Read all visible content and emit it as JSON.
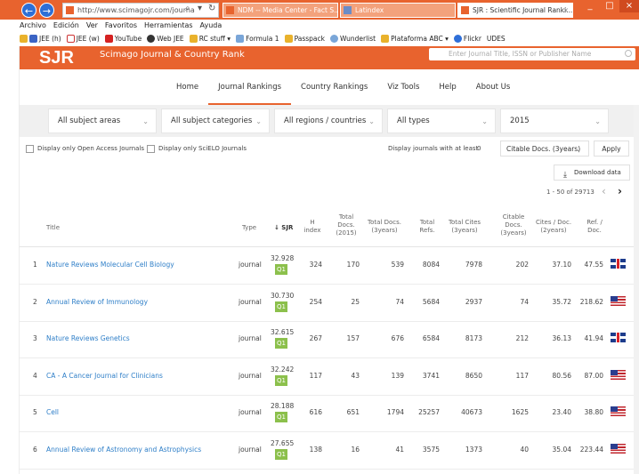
{
  "browser": {
    "address": "http://www.scimagojr.com/journa",
    "tabs": [
      {
        "label": "NDM -- Media Center - Fact S..."
      },
      {
        "label": "Latindex"
      },
      {
        "label": "SJR : Scientific Journal Ranki..."
      }
    ],
    "menu": [
      "Archivo",
      "Edición",
      "Ver",
      "Favoritos",
      "Herramientas",
      "Ayuda"
    ],
    "bookmarks": [
      "JEE (h)",
      "JEE (w)",
      "YouTube",
      "Web JEE",
      "RC stuff ▾",
      "Formula 1",
      "Passpack",
      "Wunderlist",
      "Plataforma ABC ▾",
      "Flickr",
      "UDES"
    ],
    "colors": {
      "chrome": "#e8632e",
      "link": "#2f7fc8",
      "quartile": "#8cc04c"
    }
  },
  "site": {
    "logo": "SJR",
    "subtitle": "Scimago Journal & Country Rank",
    "search_placeholder": "Enter Journal Title, ISSN or Publisher Name",
    "nav": [
      "Home",
      "Journal Rankings",
      "Country Rankings",
      "Viz Tools",
      "Help",
      "About Us"
    ]
  },
  "filters": {
    "subject_areas": "All subject areas",
    "subject_categories": "All subject categories",
    "regions": "All regions / countries",
    "types": "All types",
    "year": "2015"
  },
  "options": {
    "open_access": "Display only Open Access Journals",
    "scielo": "Display only SciELO Journals",
    "min_label": "Display journals with at least",
    "min_value": "0",
    "citable": "Citable Docs. (3years)",
    "apply": "Apply",
    "download": "Download data",
    "pager": "1 - 50 of 29713"
  },
  "table": {
    "headers": {
      "title": "Title",
      "type": "Type",
      "sjr": "↓ SJR",
      "h_index": "H index",
      "total_docs_2015": "Total Docs. (2015)",
      "total_docs_3y": "Total Docs. (3years)",
      "total_refs": "Total Refs.",
      "total_cites_3y": "Total Cites (3years)",
      "citable_docs_3y": "Citable Docs. (3years)",
      "cites_doc_2y": "Cites / Doc. (2years)",
      "ref_doc": "Ref. / Doc."
    },
    "rows": [
      {
        "rank": "1",
        "title": "Nature Reviews Molecular Cell Biology",
        "type": "journal",
        "sjr": "32.928",
        "q": "Q1",
        "h": "324",
        "docs2015": "170",
        "docs3y": "539",
        "refs": "8084",
        "cites": "7978",
        "citable": "202",
        "cites_doc": "37.10",
        "ref_doc": "47.55",
        "flag": "gb"
      },
      {
        "rank": "2",
        "title": "Annual Review of Immunology",
        "type": "journal",
        "sjr": "30.730",
        "q": "Q1",
        "h": "254",
        "docs2015": "25",
        "docs3y": "74",
        "refs": "5684",
        "cites": "2937",
        "citable": "74",
        "cites_doc": "35.72",
        "ref_doc": "218.62",
        "flag": "us"
      },
      {
        "rank": "3",
        "title": "Nature Reviews Genetics",
        "type": "journal",
        "sjr": "32.615",
        "q": "Q1",
        "h": "267",
        "docs2015": "157",
        "docs3y": "676",
        "refs": "6584",
        "cites": "8173",
        "citable": "212",
        "cites_doc": "36.13",
        "ref_doc": "41.94",
        "flag": "gb"
      },
      {
        "rank": "4",
        "title": "CA - A Cancer Journal for Clinicians",
        "type": "journal",
        "sjr": "32.242",
        "q": "Q1",
        "h": "117",
        "docs2015": "43",
        "docs3y": "139",
        "refs": "3741",
        "cites": "8650",
        "citable": "117",
        "cites_doc": "80.56",
        "ref_doc": "87.00",
        "flag": "us"
      },
      {
        "rank": "5",
        "title": "Cell",
        "type": "journal",
        "sjr": "28.188",
        "q": "Q1",
        "h": "616",
        "docs2015": "651",
        "docs3y": "1794",
        "refs": "25257",
        "cites": "40673",
        "citable": "1625",
        "cites_doc": "23.40",
        "ref_doc": "38.80",
        "flag": "us"
      },
      {
        "rank": "6",
        "title": "Annual Review of Astronomy and Astrophysics",
        "type": "journal",
        "sjr": "27.655",
        "q": "Q1",
        "h": "138",
        "docs2015": "16",
        "docs3y": "41",
        "refs": "3575",
        "cites": "1373",
        "citable": "40",
        "cites_doc": "35.04",
        "ref_doc": "223.44",
        "flag": "us"
      }
    ]
  }
}
